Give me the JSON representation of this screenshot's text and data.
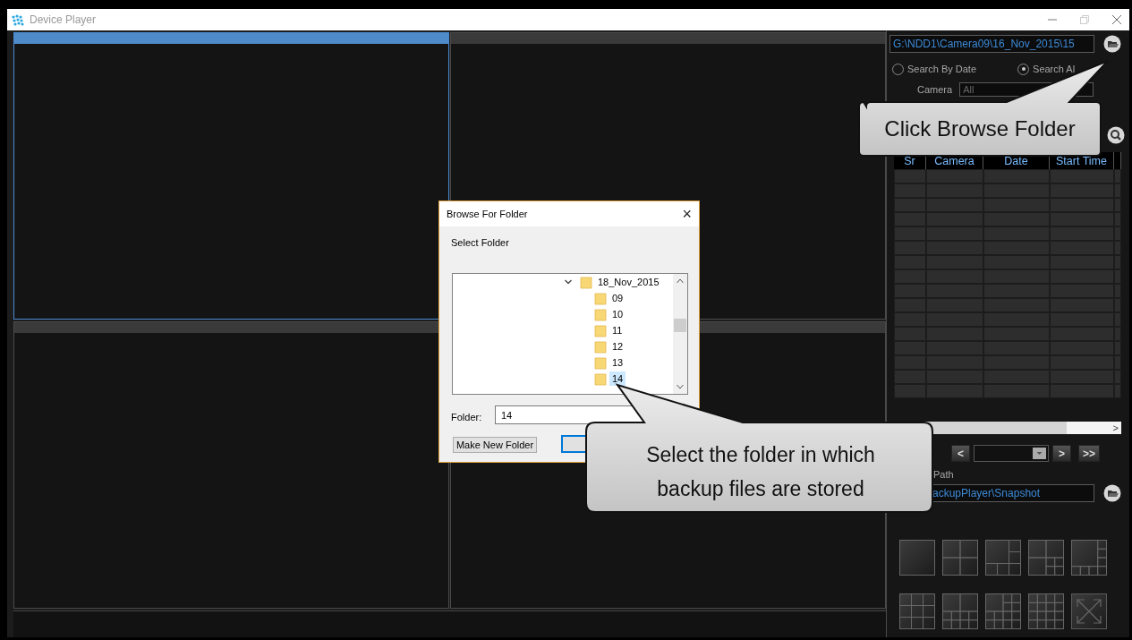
{
  "window": {
    "title": "Device Player"
  },
  "video_panes": [
    {
      "selected": true
    },
    {
      "selected": false
    },
    {
      "selected": false
    },
    {
      "selected": false
    }
  ],
  "side_panel": {
    "folder_path": "G:\\NDD1\\Camera09\\16_Nov_2015\\15",
    "search_modes": [
      {
        "label": "Search By Date",
        "selected": false
      },
      {
        "label": "Search Al",
        "selected": true
      }
    ],
    "camera": {
      "label": "Camera",
      "value": "All"
    },
    "table": {
      "columns": [
        "Sr",
        "Camera",
        "Date",
        "Start Time"
      ]
    },
    "scroll_arrow": ">",
    "nav_buttons": [
      "<",
      ">",
      ">>"
    ],
    "snapshot": {
      "label": "Path",
      "value": "ackupPlayer\\Snapshot"
    },
    "layouts": [
      {
        "kind": "single"
      },
      {
        "kind": "quad"
      },
      {
        "kind": "six"
      },
      {
        "kind": "seven"
      },
      {
        "kind": "eight"
      },
      {
        "kind": "nine"
      },
      {
        "kind": "ten"
      },
      {
        "kind": "thirteen"
      },
      {
        "kind": "sixteen"
      },
      {
        "kind": "fullscreen"
      }
    ]
  },
  "dialog": {
    "title": "Browse For Folder",
    "close": "×",
    "prompt": "Select Folder",
    "tree": [
      {
        "label": "18_Nov_2015",
        "expanded": true,
        "selected": false,
        "children": [
          {
            "label": "09",
            "selected": false
          },
          {
            "label": "10",
            "selected": false
          },
          {
            "label": "11",
            "selected": false
          },
          {
            "label": "12",
            "selected": false
          },
          {
            "label": "13",
            "selected": false
          },
          {
            "label": "14",
            "selected": true
          }
        ]
      }
    ],
    "folder_label": "Folder:",
    "folder_value": "14",
    "make_button": "Make New Folder"
  },
  "callouts": [
    {
      "text": "Click Browse Folder"
    },
    {
      "text": "Select the folder in which backup files are stored"
    }
  ]
}
